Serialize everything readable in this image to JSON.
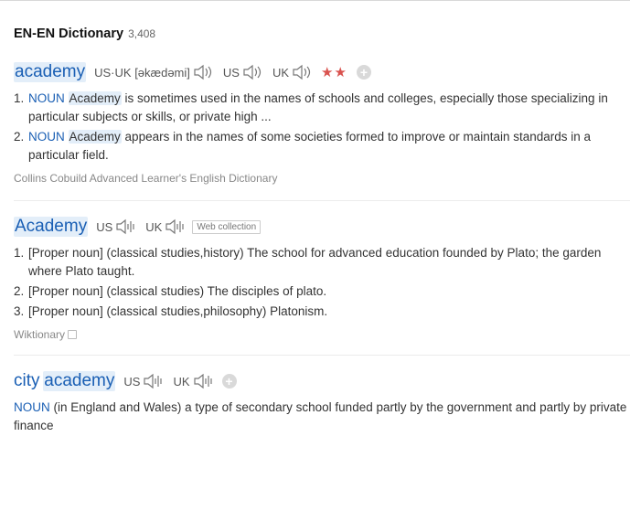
{
  "header": {
    "title": "EN-EN Dictionary",
    "count": "3,408"
  },
  "entry1": {
    "word": "academy",
    "pron_both_label": "US·UK",
    "ipa": "[əkædəmi]",
    "us_label": "US",
    "uk_label": "UK",
    "stars": "★★",
    "defs": [
      {
        "num": "1.",
        "pos": "NOUN",
        "head": "Academy",
        "text": " is sometimes used in the names of schools and colleges, especially those specializing in particular subjects or skills, or private high ..."
      },
      {
        "num": "2.",
        "pos": "NOUN",
        "head": "Academy",
        "text": " appears in the names of some societies formed to improve or maintain standards in a particular field."
      }
    ],
    "source": "Collins Cobuild Advanced Learner's English Dictionary"
  },
  "entry2": {
    "word": "Academy",
    "us_label": "US",
    "uk_label": "UK",
    "tag": "Web collection",
    "defs": [
      {
        "num": "1.",
        "text": "[Proper noun] (classical studies,history) The school for advanced education founded by Plato; the garden where Plato taught."
      },
      {
        "num": "2.",
        "text": "[Proper noun] (classical studies) The disciples of plato."
      },
      {
        "num": "3.",
        "text": "[Proper noun] (classical studies,philosophy) Platonism."
      }
    ],
    "source": "Wiktionary"
  },
  "entry3": {
    "word_prefix": "city",
    "word_head": "academy",
    "us_label": "US",
    "uk_label": "UK",
    "pos": "NOUN",
    "text": " (in England and Wales) a type of secondary school funded partly by the government and partly by private finance"
  },
  "colors": {
    "link": "#1a5fb4",
    "highlight": "#e3eef9",
    "stars": "#d9534f"
  },
  "icons": [
    "speaker-icon",
    "wave-speaker-icon",
    "add-icon",
    "copy-icon"
  ]
}
